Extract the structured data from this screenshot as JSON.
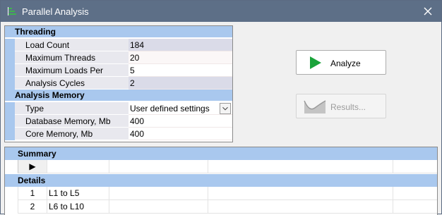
{
  "window": {
    "title": "Parallel Analysis",
    "icon": "parallel-analysis-icon",
    "close_icon": "close-icon"
  },
  "threading": {
    "header": "Threading",
    "rows": [
      {
        "name": "Load Count",
        "value": "184"
      },
      {
        "name": "Maximum Threads",
        "value": "20"
      },
      {
        "name": "Maximum Loads Per Thread",
        "value": "5"
      },
      {
        "name": "Analysis Cycles",
        "value": "2"
      }
    ]
  },
  "memory": {
    "header": "Analysis Memory",
    "rows": [
      {
        "name": "Type",
        "value": "User defined settings"
      },
      {
        "name": "Database Memory, Mb",
        "value": "400"
      },
      {
        "name": "Core Memory, Mb",
        "value": "400"
      }
    ]
  },
  "buttons": {
    "analyze": "Analyze",
    "results": "Results..."
  },
  "summary": {
    "header": "Summary",
    "row_marker": "▶"
  },
  "details": {
    "header": "Details",
    "rows": [
      {
        "index": "1",
        "range": "L1 to L5"
      },
      {
        "index": "2",
        "range": "L6 to L10"
      }
    ]
  },
  "colors": {
    "titlebar": "#5d6f87",
    "section_header": "#a9c8ee",
    "analyze_green": "#1aa33a"
  }
}
